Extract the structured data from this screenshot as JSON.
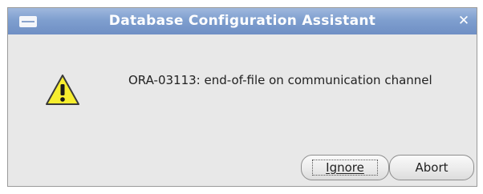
{
  "window": {
    "title": "Database Configuration Assistant",
    "close_glyph": "✕"
  },
  "dialog": {
    "icon": "warning-icon",
    "message": "ORA-03113: end-of-file on communication channel"
  },
  "buttons": {
    "ignore_label": "Ignore",
    "abort_label": "Abort"
  },
  "colors": {
    "titlebar": "#7f9fcf",
    "dialog_background": "#e8e8e8",
    "warning_fill": "#f7ee2f"
  }
}
